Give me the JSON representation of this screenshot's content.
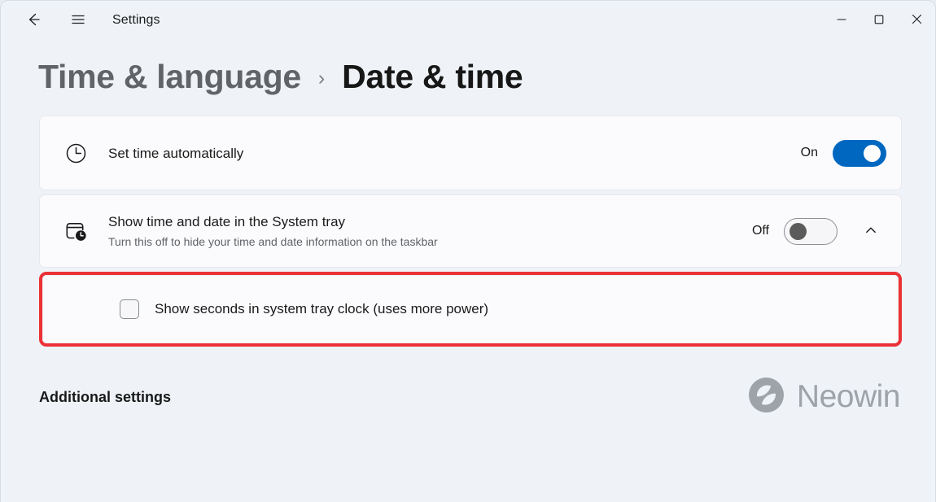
{
  "window": {
    "title": "Settings",
    "back_icon": "back-arrow-icon",
    "menu_icon": "hamburger-menu-icon",
    "controls": {
      "minimize": "minimize-icon",
      "maximize": "maximize-icon",
      "close": "close-icon"
    }
  },
  "breadcrumb": {
    "parent": "Time & language",
    "separator": "›",
    "current": "Date & time"
  },
  "settings": {
    "set_time_automatically": {
      "icon": "clock-icon",
      "title": "Set time automatically",
      "toggle_state_label": "On",
      "toggle_on": true
    },
    "show_time_and_date": {
      "icon": "calendar-clock-icon",
      "title": "Show time and date in the System tray",
      "subtitle": "Turn this off to hide your time and date information on the taskbar",
      "toggle_state_label": "Off",
      "toggle_on": false,
      "expander_icon": "chevron-up-icon"
    },
    "show_seconds": {
      "label": "Show seconds in system tray clock (uses more power)",
      "checked": false,
      "highlighted": true
    }
  },
  "footer": {
    "heading": "Additional settings",
    "watermark": {
      "logo_icon": "neowin-logo-icon",
      "text": "Neowin"
    }
  },
  "colors": {
    "page_background": "#eff3f8",
    "card_background": "#fbfbfd",
    "accent_blue": "#0067c0",
    "highlight_red": "#ec3237",
    "text_primary": "#1a1a1a",
    "text_secondary": "#5f6368",
    "breadcrumb_parent": "#606467"
  }
}
